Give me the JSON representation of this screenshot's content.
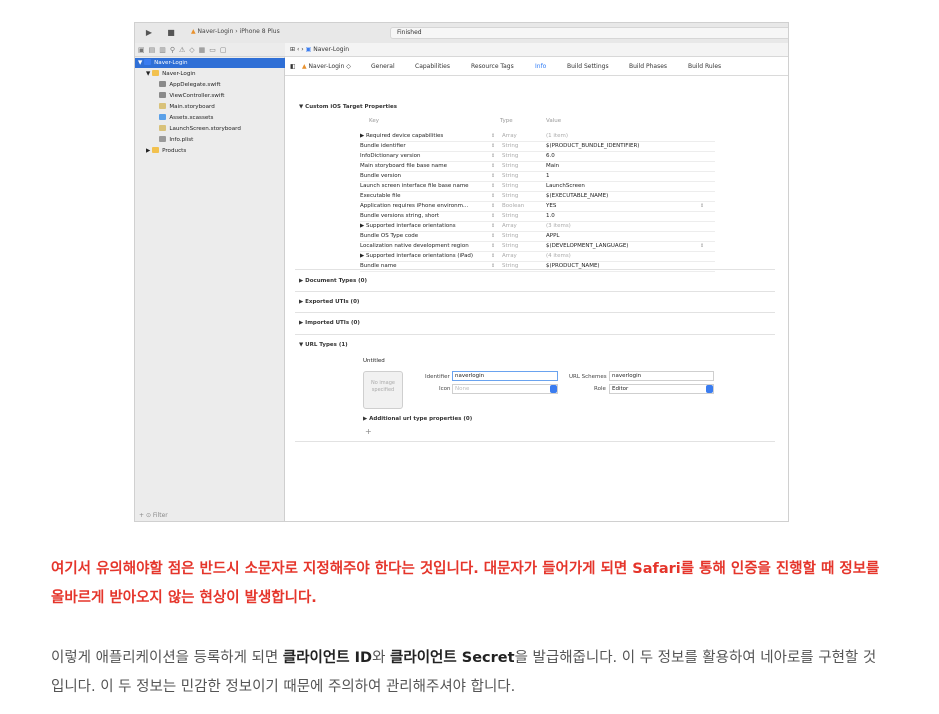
{
  "toolbar": {
    "scheme": "Naver-Login",
    "device": "iPhone 8 Plus",
    "status": "Finished"
  },
  "navigator": {
    "items": [
      {
        "label": "Naver-Login",
        "level": 0,
        "arrow": "▼",
        "icon": "project",
        "selected": true
      },
      {
        "label": "Naver-Login",
        "level": 1,
        "arrow": "▼",
        "icon": "folder"
      },
      {
        "label": "AppDelegate.swift",
        "level": 2,
        "icon": "file"
      },
      {
        "label": "ViewController.swift",
        "level": 2,
        "icon": "file"
      },
      {
        "label": "Main.storyboard",
        "level": 2,
        "icon": "storyboard"
      },
      {
        "label": "Assets.xcassets",
        "level": 2,
        "icon": "assets"
      },
      {
        "label": "LaunchScreen.storyboard",
        "level": 2,
        "icon": "storyboard"
      },
      {
        "label": "Info.plist",
        "level": 2,
        "icon": "plist"
      },
      {
        "label": "Products",
        "level": 1,
        "arrow": "▶",
        "icon": "folder"
      }
    ],
    "filter_placeholder": "Filter"
  },
  "jumpbar": {
    "label": "Naver-Login"
  },
  "editor": {
    "target": "Naver-Login ◇",
    "tabs": [
      "General",
      "Capabilities",
      "Resource Tags",
      "Info",
      "Build Settings",
      "Build Phases",
      "Build Rules"
    ],
    "active_tab": "Info"
  },
  "custom_props": {
    "title": "Custom iOS Target Properties",
    "head_key": "Key",
    "head_type": "Type",
    "head_value": "Value",
    "rows": [
      {
        "key": "▶ Required device capabilities",
        "type": "Array",
        "value": "(1 item)",
        "muted": true
      },
      {
        "key": "Bundle identifier",
        "type": "String",
        "value": "$(PRODUCT_BUNDLE_IDENTIFIER)"
      },
      {
        "key": "InfoDictionary version",
        "type": "String",
        "value": "6.0"
      },
      {
        "key": "Main storyboard file base name",
        "type": "String",
        "value": "Main"
      },
      {
        "key": "Bundle version",
        "type": "String",
        "value": "1"
      },
      {
        "key": "Launch screen interface file base name",
        "type": "String",
        "value": "LaunchScreen"
      },
      {
        "key": "Executable file",
        "type": "String",
        "value": "$(EXECUTABLE_NAME)"
      },
      {
        "key": "Application requires iPhone environm...",
        "type": "Boolean",
        "value": "YES"
      },
      {
        "key": "Bundle versions string, short",
        "type": "String",
        "value": "1.0"
      },
      {
        "key": "▶ Supported interface orientations",
        "type": "Array",
        "value": "(3 items)",
        "muted": true
      },
      {
        "key": "Bundle OS Type code",
        "type": "String",
        "value": "APPL"
      },
      {
        "key": "Localization native development region",
        "type": "String",
        "value": "$(DEVELOPMENT_LANGUAGE)"
      },
      {
        "key": "▶ Supported interface orientations (iPad)",
        "type": "Array",
        "value": "(4 items)",
        "muted": true
      },
      {
        "key": "Bundle name",
        "type": "String",
        "value": "$(PRODUCT_NAME)"
      }
    ]
  },
  "sections": {
    "document_types": "Document Types (0)",
    "exported_utis": "Exported UTIs (0)",
    "imported_utis": "Imported UTIs (0)",
    "url_types": "URL Types (1)"
  },
  "url_type": {
    "name": "Untitled",
    "no_image": "No image specified",
    "identifier_label": "Identifier",
    "identifier_value": "naverlogin",
    "icon_label": "Icon",
    "icon_placeholder": "None",
    "schemes_label": "URL Schemes",
    "schemes_value": "naverlogin",
    "role_label": "Role",
    "role_value": "Editor",
    "additional": "Additional url type properties (0)"
  },
  "article": {
    "warning": "여기서 유의해야할 점은 반드시 소문자로 지정해주야 한다는 것입니다. 대문자가 들어가게 되면 Safari를 통해 인증을 진행할 때 정보를 올바르게 받아오지 않는 현상이 발생합니다.",
    "body_1": "이렇게 애플리케이션을 등록하게 되면 ",
    "client_id": "클라이언트 ID",
    "body_2": "와 ",
    "client_secret": "클라이언트 Secret",
    "body_3": "을 발급해줍니다. 이 두 정보를 활용하여 네아로를 구현할 것입니다. 이 두 정보는 민감한 정보이기 때문에 주의하여 관리해주셔야 합니다."
  }
}
